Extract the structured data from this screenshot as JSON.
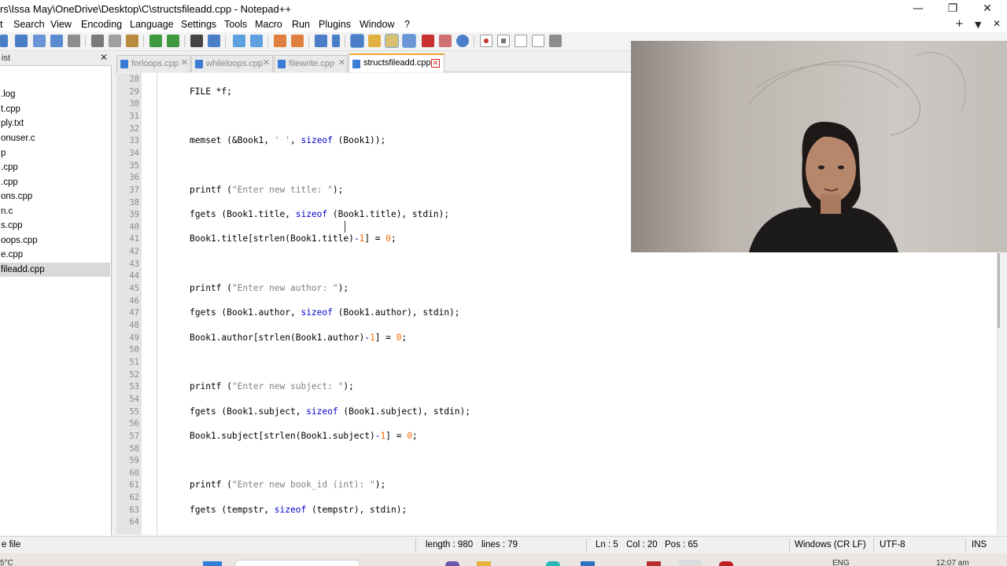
{
  "window": {
    "title": "rs\\Issa May\\OneDrive\\Desktop\\C\\structsfileadd.cpp - Notepad++",
    "minimize_glyph": "—",
    "restore_glyph": "❐",
    "close_glyph": "✕"
  },
  "menubar": {
    "items": [
      "t",
      "Search",
      "View",
      "Encoding",
      "Language",
      "Settings",
      "Tools",
      "Macro",
      "Run",
      "Plugins",
      "Window",
      "?"
    ],
    "add_glyph": "+",
    "list_glyph": "▼",
    "close_glyph": "✕"
  },
  "toolbar": {
    "icons": [
      "open-file-icon",
      "save-icon",
      "save-all-icon",
      "close-file-icon",
      "print-icon",
      "cut-icon",
      "copy-icon",
      "paste-icon",
      "undo-icon",
      "redo-icon",
      "find-icon",
      "replace-icon",
      "zoom-in-icon",
      "zoom-out-icon",
      "sync-v-icon",
      "sync-h-icon",
      "word-wrap-icon",
      "show-all-chars-icon",
      "indent-guide-icon",
      "doc-map-icon",
      "function-list-icon",
      "folder-workspace-icon",
      "monitoring-icon",
      "record-macro-icon",
      "stop-macro-icon",
      "play-macro-icon",
      "run-macro-icon",
      "save-macro-icon"
    ],
    "colors": {
      "blue": "#4a7fc8",
      "red": "#c83030",
      "green": "#3f9a3f",
      "gray": "#8d8d8d",
      "yellow": "#e0b040"
    }
  },
  "left_panel": {
    "header": "ist",
    "close_glyph": "✕",
    "items": [
      ".log",
      "t.cpp",
      "ply.txt",
      "onuser.c",
      "p",
      ".cpp",
      ".cpp",
      "ons.cpp",
      "n.c",
      "s.cpp",
      "oops.cpp",
      "e.cpp",
      "fileadd.cpp"
    ],
    "selected_index": 12
  },
  "tabs": [
    {
      "label": "forloops.cpp",
      "active": false
    },
    {
      "label": "whileloops.cpp",
      "active": false
    },
    {
      "label": "filewrite.cpp",
      "active": false
    },
    {
      "label": "structsfileadd.cpp",
      "active": true
    }
  ],
  "tab_close_glyph": "✕",
  "editor": {
    "lines": [
      {
        "n": "28",
        "code": []
      },
      {
        "n": "29",
        "code": [
          [
            "",
            "FILE *f;"
          ]
        ]
      },
      {
        "n": "30",
        "code": []
      },
      {
        "n": "31",
        "code": []
      },
      {
        "n": "32",
        "code": []
      },
      {
        "n": "33",
        "code": [
          [
            "",
            "memset (&Book1, "
          ],
          [
            "str",
            "' '"
          ],
          [
            "",
            ", "
          ],
          [
            "kw",
            "sizeof"
          ],
          [
            "",
            " (Book1));"
          ]
        ]
      },
      {
        "n": "34",
        "code": []
      },
      {
        "n": "35",
        "code": []
      },
      {
        "n": "36",
        "code": []
      },
      {
        "n": "37",
        "code": [
          [
            "",
            "printf ("
          ],
          [
            "str",
            "\"Enter new title: \""
          ],
          [
            "",
            ");"
          ]
        ]
      },
      {
        "n": "38",
        "code": []
      },
      {
        "n": "39",
        "code": [
          [
            "",
            "fgets (Book1.title, "
          ],
          [
            "kw",
            "sizeof"
          ],
          [
            "",
            " (Book1.title), stdin);"
          ]
        ]
      },
      {
        "n": "40",
        "code": []
      },
      {
        "n": "41",
        "code": [
          [
            "",
            "Book1.title[strlen(Book1.title)"
          ],
          [
            "op",
            "-"
          ],
          [
            "num",
            "1"
          ],
          [
            "",
            "] = "
          ],
          [
            "num",
            "0"
          ],
          [
            "",
            ";"
          ]
        ]
      },
      {
        "n": "42",
        "code": []
      },
      {
        "n": "43",
        "code": []
      },
      {
        "n": "44",
        "code": []
      },
      {
        "n": "45",
        "code": [
          [
            "",
            "printf ("
          ],
          [
            "str",
            "\"Enter new author: \""
          ],
          [
            "",
            ");"
          ]
        ]
      },
      {
        "n": "46",
        "code": []
      },
      {
        "n": "47",
        "code": [
          [
            "",
            "fgets (Book1.author, "
          ],
          [
            "kw",
            "sizeof"
          ],
          [
            "",
            " (Book1.author), stdin);"
          ]
        ]
      },
      {
        "n": "48",
        "code": []
      },
      {
        "n": "49",
        "code": [
          [
            "",
            "Book1.author[strlen(Book1.author)"
          ],
          [
            "op",
            "-"
          ],
          [
            "num",
            "1"
          ],
          [
            "",
            "] = "
          ],
          [
            "num",
            "0"
          ],
          [
            "",
            ";"
          ]
        ]
      },
      {
        "n": "50",
        "code": []
      },
      {
        "n": "51",
        "code": []
      },
      {
        "n": "52",
        "code": []
      },
      {
        "n": "53",
        "code": [
          [
            "",
            "printf ("
          ],
          [
            "str",
            "\"Enter new subject: \""
          ],
          [
            "",
            ");"
          ]
        ]
      },
      {
        "n": "54",
        "code": []
      },
      {
        "n": "55",
        "code": [
          [
            "",
            "fgets (Book1.subject, "
          ],
          [
            "kw",
            "sizeof"
          ],
          [
            "",
            " (Book1.subject), stdin);"
          ]
        ]
      },
      {
        "n": "56",
        "code": []
      },
      {
        "n": "57",
        "code": [
          [
            "",
            "Book1.subject[strlen(Book1.subject)"
          ],
          [
            "op",
            "-"
          ],
          [
            "num",
            "1"
          ],
          [
            "",
            "] = "
          ],
          [
            "num",
            "0"
          ],
          [
            "",
            ";"
          ]
        ]
      },
      {
        "n": "58",
        "code": []
      },
      {
        "n": "59",
        "code": []
      },
      {
        "n": "60",
        "code": []
      },
      {
        "n": "61",
        "code": [
          [
            "",
            "printf ("
          ],
          [
            "str",
            "\"Enter new book_id (int): \""
          ],
          [
            "",
            ");"
          ]
        ]
      },
      {
        "n": "62",
        "code": []
      },
      {
        "n": "63",
        "code": [
          [
            "",
            "fgets (tempstr, "
          ],
          [
            "kw",
            "sizeof"
          ],
          [
            "",
            " (tempstr), stdin);"
          ]
        ]
      },
      {
        "n": "64",
        "code": []
      }
    ]
  },
  "status": {
    "file_type": "e file",
    "length": "length : 980",
    "lines": "lines : 79",
    "ln": "Ln : 5",
    "col": "Col : 20",
    "pos": "Pos : 65",
    "eol": "Windows (CR LF)",
    "encoding": "UTF-8",
    "mode": "INS"
  },
  "taskbar": {
    "temperature": "5°C",
    "language": "ENG",
    "time": "12:07 am"
  }
}
